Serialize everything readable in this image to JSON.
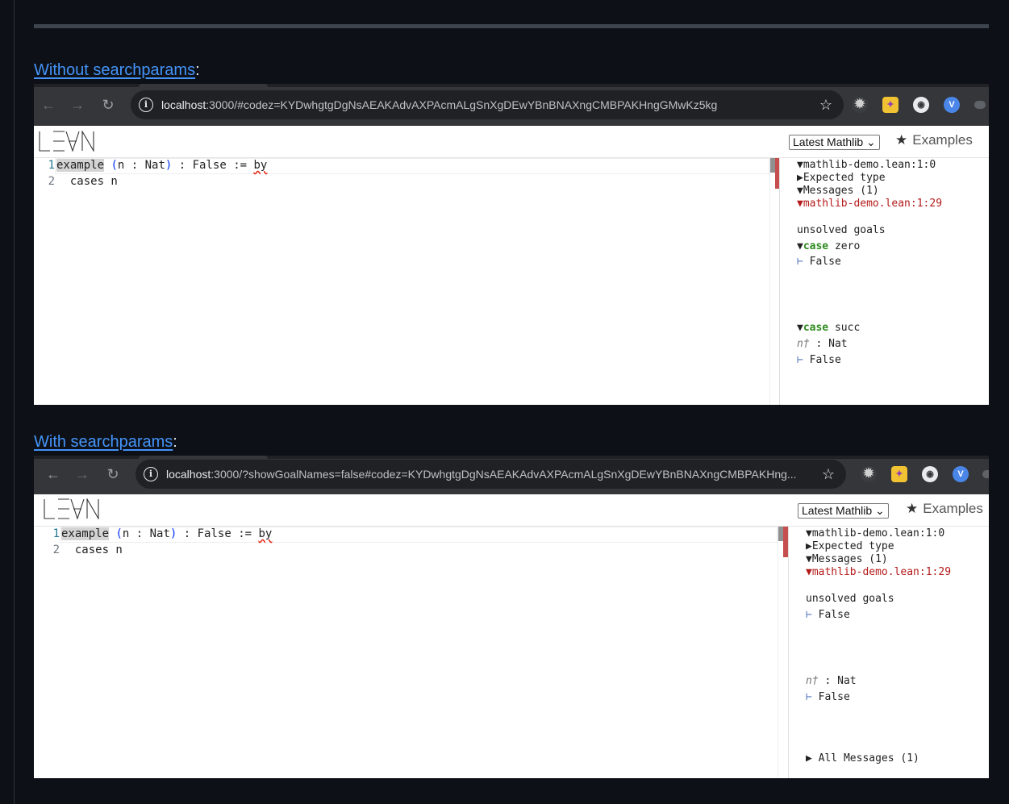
{
  "headings": {
    "without": {
      "link": "Without searchparams",
      "suffix": ":"
    },
    "with": {
      "link": "With searchparams",
      "suffix": ":"
    }
  },
  "browser": {
    "shot1": {
      "host": "localhost",
      "rest": ":3000/#codez=KYDwhgtgDgNsAEAKAdvAXPAcmALgSnXgDEwYBnBNAXngCMBPAKHngGMwKz5kg"
    },
    "shot2": {
      "host": "localhost",
      "rest": ":3000/?showGoalNames=false#codez=KYDwhgtgDgNsAEAKAdvAXPAcmALgSnXgDEwYBnBNAXngCMBPAKHng..."
    }
  },
  "app": {
    "mathlib_select": "Latest Mathlib",
    "examples": "Examples"
  },
  "editor": {
    "line_numbers": [
      "1",
      "2"
    ],
    "line1": {
      "kw": "example",
      "sp1": " ",
      "paren_open": "(",
      "mid": "n : Nat",
      "paren_close": ")",
      "tail": " : False := ",
      "by": "by"
    },
    "line2": "  cases n"
  },
  "infoview1": {
    "file": "mathlib-demo.lean:1:0",
    "expected_type": "Expected type",
    "messages": "Messages (1)",
    "msg_loc": "mathlib-demo.lean:1:29",
    "unsolved": "unsolved goals",
    "case_kw": "case",
    "case1_name": "zero",
    "case2_name": "succ",
    "goal": "False",
    "hyp_name": "n†",
    "hyp_type": " : Nat",
    "turnstile": "⊢"
  },
  "infoview2": {
    "file": "mathlib-demo.lean:1:0",
    "expected_type": "Expected type",
    "messages": "Messages (1)",
    "msg_loc": "mathlib-demo.lean:1:29",
    "unsolved": "unsolved goals",
    "goal": "False",
    "hyp_name": "n†",
    "hyp_type": " : Nat",
    "turnstile": "⊢",
    "all_messages": "All Messages (1)"
  },
  "triangles": {
    "down": "▼",
    "right": "▶"
  },
  "colors": {
    "link": "#4493f8",
    "error_red": "#b51a1a",
    "case_green": "#2e8b1e"
  }
}
